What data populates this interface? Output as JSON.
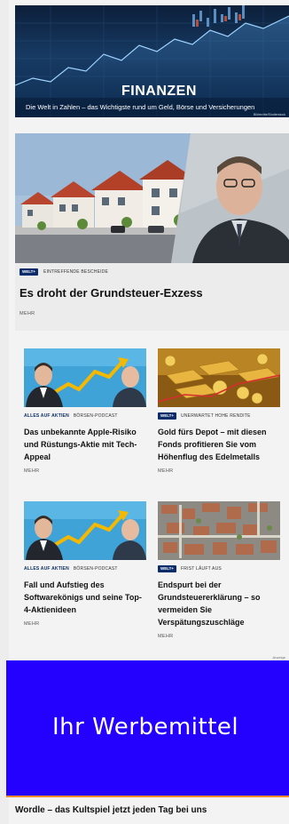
{
  "finanzen_banner": {
    "title": "FINANZEN",
    "subtitle": "Die Welt in Zahlen – das Wichtigste rund um Geld, Börse und Versicherungen",
    "credit": "Bildrechte/Shutterstock"
  },
  "main_teaser": {
    "badge": "WELT+",
    "kicker": "EINTREFFENDE BESCHEIDE",
    "headline": "Es droht der Grundsteuer-Exzess",
    "more": "MEHR"
  },
  "cards": [
    {
      "badge": "ALLES AUF AKTIEN",
      "kicker": "BÖRSEN-PODCAST",
      "headline": "Das unbekannte Apple-Risiko und Rüstungs-Aktie mit Tech-Appeal",
      "more": "MEHR",
      "image": "podcast-hosts"
    },
    {
      "badge": "WELT+",
      "kicker": "UNERWARTET HOHE RENDITE",
      "headline": "Gold fürs Depot – mit diesen Fonds profitieren Sie vom Höhenflug des Edelmetalls",
      "more": "MEHR",
      "image": "gold"
    },
    {
      "badge": "ALLES AUF AKTIEN",
      "kicker": "BÖRSEN-PODCAST",
      "headline": "Fall und Aufstieg des Softwarekönigs und seine Top-4-Aktienideen",
      "more": "MEHR",
      "image": "podcast-hosts"
    },
    {
      "badge": "WELT+",
      "kicker": "FRIST LÄUFT AUS",
      "headline": "Endspurt bei der Grundsteuererklärung – so vermeiden Sie Verspätungszuschläge",
      "more": "MEHR",
      "image": "aerial-city"
    }
  ],
  "ad": {
    "label": "Anzeige",
    "text": "Ihr Werbemittel"
  },
  "bottom_teaser": {
    "headline": "Wordle – das Kultspiel jetzt jeden Tag bei uns"
  },
  "colors": {
    "welt_blue": "#0a2c6a",
    "ad_blue": "#2300ff",
    "accent_orange": "#f08a2a"
  }
}
